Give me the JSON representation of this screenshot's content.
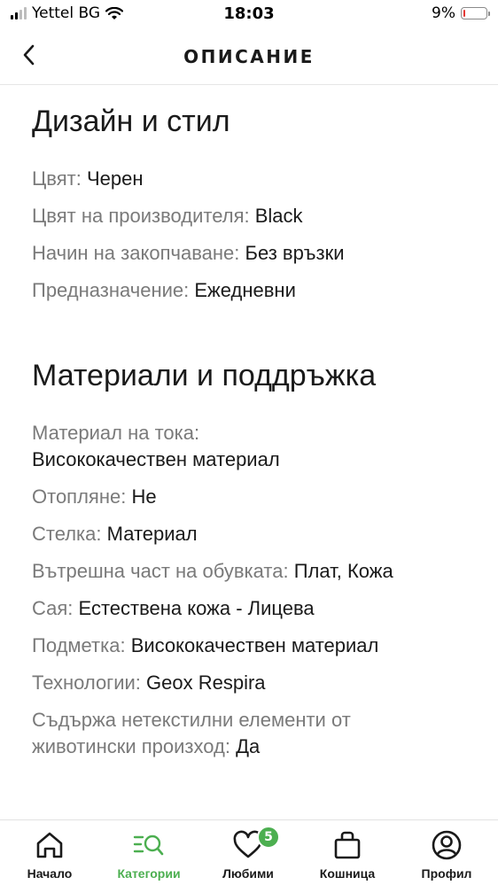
{
  "status_bar": {
    "carrier": "Yettel BG",
    "time": "18:03",
    "battery": "9%",
    "battery_level": 0.09
  },
  "header": {
    "title": "ОПИСАНИЕ",
    "back_icon": "chevron-left-icon"
  },
  "sections": [
    {
      "title": "Дизайн и стил",
      "specs": [
        {
          "label": "Цвят:",
          "value": "Черен"
        },
        {
          "label": "Цвят на производителя:",
          "value": "Black"
        },
        {
          "label": "Начин на закопчаване:",
          "value": "Без връзки"
        },
        {
          "label": "Предназначение:",
          "value": "Ежедневни"
        }
      ]
    },
    {
      "title": "Материали и поддръжка",
      "specs": [
        {
          "label": "Материал на тока:",
          "value": "Висококачествен материал"
        },
        {
          "label": "Отопляне:",
          "value": "Не"
        },
        {
          "label": "Стелка:",
          "value": "Материал"
        },
        {
          "label": "Вътрешна част на обувката:",
          "value": "Плат, Кожа"
        },
        {
          "label": "Сая:",
          "value": "Естествена кожа - Лицева"
        },
        {
          "label": "Подметка:",
          "value": "Висококачествен материал"
        },
        {
          "label": "Технологии:",
          "value": "Geox Respira"
        },
        {
          "label": "Съдържа нетекстилни елементи от животински произход:",
          "value": "Да"
        }
      ]
    }
  ],
  "bottom_nav": {
    "items": [
      {
        "label": "Начало",
        "icon": "home-icon"
      },
      {
        "label": "Категории",
        "icon": "categories-search-icon"
      },
      {
        "label": "Любими",
        "icon": "heart-icon",
        "badge": "5"
      },
      {
        "label": "Кошница",
        "icon": "shopping-bag-icon"
      },
      {
        "label": "Профил",
        "icon": "profile-icon"
      }
    ],
    "active_color": "#4caf50"
  }
}
